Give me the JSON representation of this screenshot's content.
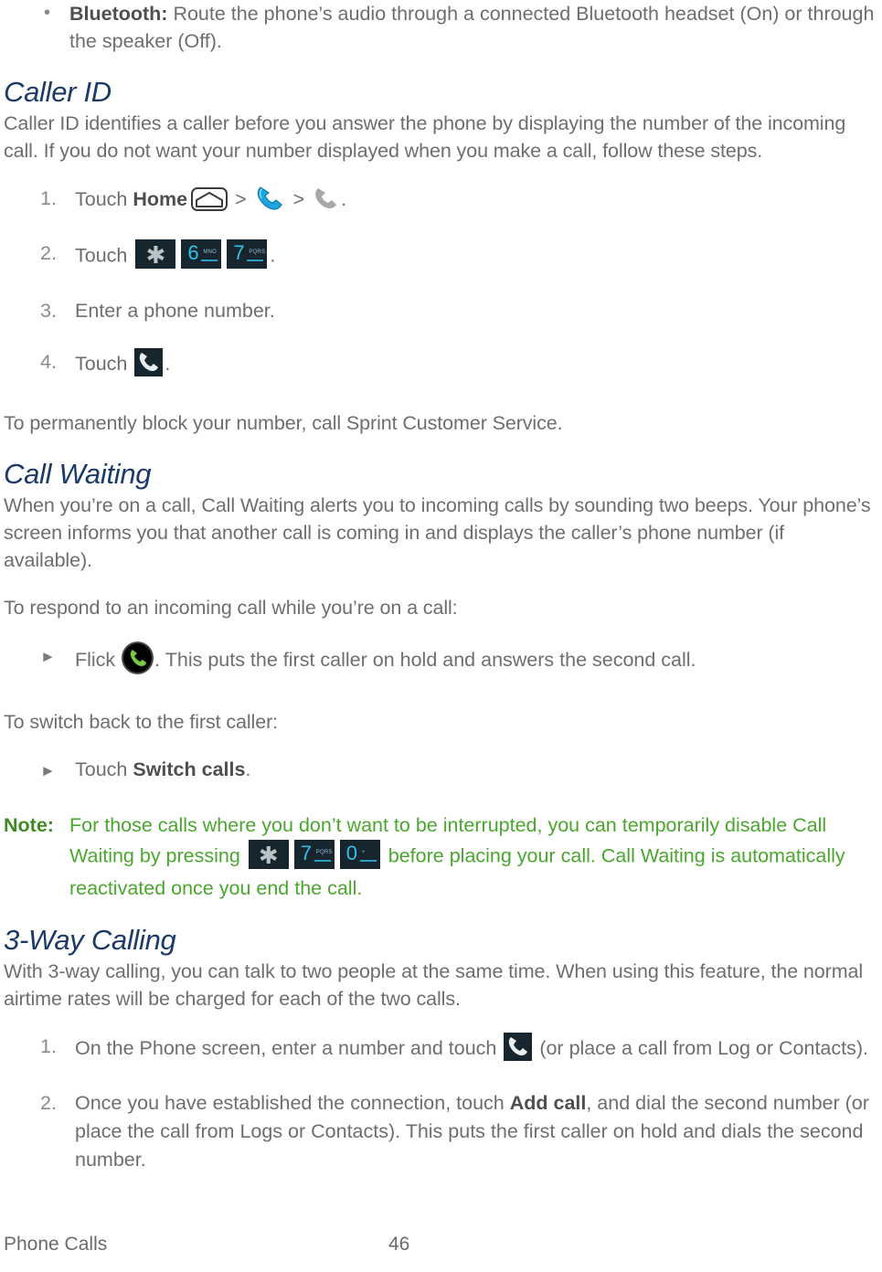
{
  "document": {
    "footer": {
      "section": "Phone Calls",
      "page_number": "46"
    }
  },
  "colors": {
    "heading": "#1b3a68",
    "body": "#6e6e6e",
    "bold": "#4f4f4f",
    "note": "#4aa72e",
    "note_label": "#3f8a22",
    "key_background": "#16252e",
    "key_digit": "#33c0e8",
    "phone_blue": "#1ba4dd",
    "phone_green": "#7ac943"
  },
  "blocks": {
    "bluetooth_bullet": {
      "term": "Bluetooth:",
      "text": " Route the phone’s audio through a connected Bluetooth headset (On) or through the speaker (Off)."
    },
    "caller_id": {
      "heading": "Caller ID",
      "intro": "Caller ID identifies a caller before you answer the phone by displaying the number of the incoming call. If you do not want your number displayed when you make a call, follow these steps.",
      "steps": {
        "step1_pre": "Touch ",
        "step1_home": "Home",
        "step1_sep1": " > ",
        "step1_sep2": " > ",
        "step1_end": ".",
        "step2_pre": "Touch ",
        "step2_end": ".",
        "step3": "Enter a phone number.",
        "step4_pre": "Touch ",
        "step4_end": "."
      },
      "outro": "To permanently block your number, call Sprint Customer Service."
    },
    "call_waiting": {
      "heading": "Call Waiting",
      "intro": "When you’re on a call, Call Waiting alerts you to incoming calls by sounding two beeps. Your phone’s screen informs you that another call is coming in and displays the caller’s phone number (if available).",
      "respond_lead": "To respond to an incoming call while you’re on a call:",
      "flick_pre": "Flick ",
      "flick_post": ". This puts the first caller on hold and answers the second call.",
      "switch_lead": "To switch back to the first caller:",
      "switch_pre": "Touch ",
      "switch_bold": "Switch calls",
      "switch_end": ".",
      "note_label": "Note:",
      "note_part1": "For those calls where you don’t want to be interrupted, you can temporarily disable Call Waiting by pressing ",
      "note_part2": " before placing your call. Call Waiting is automatically reactivated once you end the call."
    },
    "three_way": {
      "heading": "3-Way Calling",
      "intro": "With 3-way calling, you can talk to two people at the same time. When using this feature, the normal airtime rates will be charged for each of the two calls.",
      "step1_pre": "On the Phone screen, enter a number and touch ",
      "step1_post": " (or place a call from Log or Contacts).",
      "step2_pre": "Once you have established the connection, touch ",
      "step2_bold": "Add call",
      "step2_post": ", and dial the second number (or place the call from Logs or Contacts). This puts the first caller on hold and dials the second number."
    }
  },
  "keys": {
    "star": {
      "digit": "✱",
      "letters": ""
    },
    "six": {
      "digit": "6",
      "letters": "MNO"
    },
    "seven": {
      "digit": "7",
      "letters": "PQRS"
    },
    "zero": {
      "digit": "0",
      "letters": "+"
    }
  }
}
